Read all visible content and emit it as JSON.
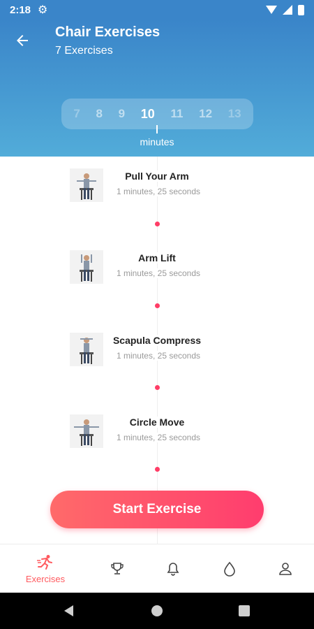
{
  "status_bar": {
    "time": "2:18"
  },
  "header": {
    "title": "Chair Exercises",
    "subtitle": "7 Exercises",
    "picker_values": [
      "7",
      "8",
      "9",
      "10",
      "11",
      "12",
      "13"
    ],
    "picker_selected": "10",
    "picker_unit": "minutes"
  },
  "exercises": [
    {
      "name": "Pull Your Arm",
      "duration": "1 minutes, 25 seconds"
    },
    {
      "name": "Arm Lift",
      "duration": "1 minutes, 25 seconds"
    },
    {
      "name": "Scapula Compress",
      "duration": "1 minutes, 25 seconds"
    },
    {
      "name": "Circle Move",
      "duration": "1 minutes, 25 seconds"
    }
  ],
  "start_button": {
    "label": "Start Exercise"
  },
  "bottom_nav": {
    "items": [
      {
        "label": "Exercises",
        "icon": "running-icon",
        "active": true
      },
      {
        "icon": "trophy-icon"
      },
      {
        "icon": "bell-icon"
      },
      {
        "icon": "water-drop-icon"
      },
      {
        "icon": "person-icon"
      }
    ]
  },
  "colors": {
    "header_top": "#3a85c9",
    "header_bottom": "#52acd9",
    "accent": "#ff3d66",
    "button_start": "#ff6a6a",
    "button_end": "#ff3d6e"
  }
}
